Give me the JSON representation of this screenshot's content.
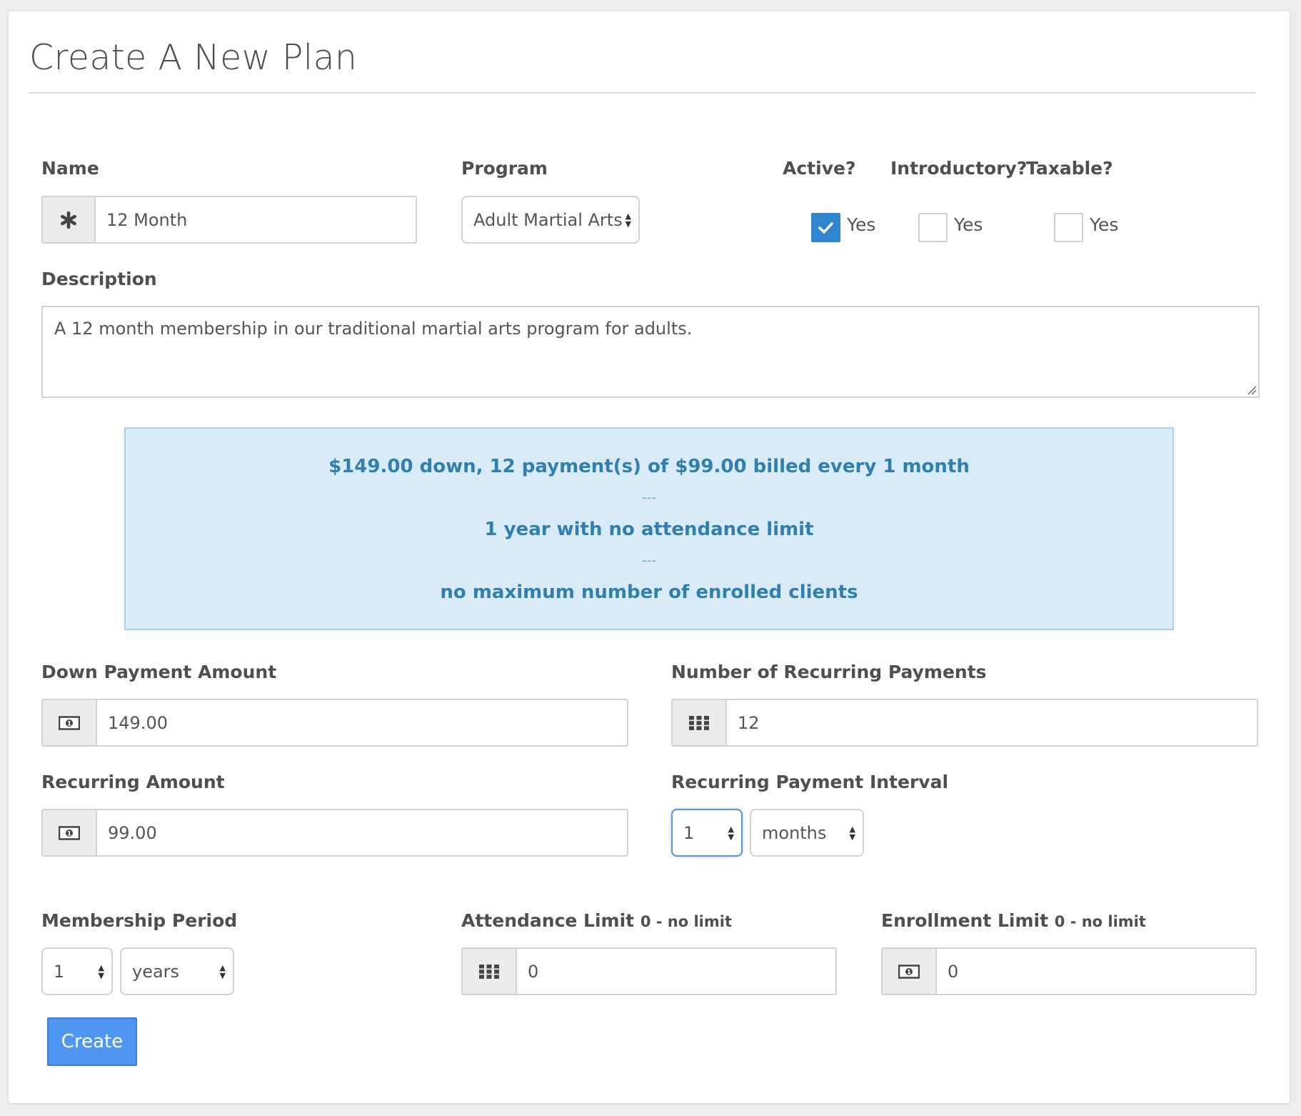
{
  "page": {
    "title": "Create A New Plan"
  },
  "fields": {
    "name": {
      "label": "Name",
      "value": "12 Month",
      "icon": "asterisk-icon"
    },
    "program": {
      "label": "Program",
      "value": "Adult Martial Arts"
    },
    "active": {
      "label": "Active?",
      "option": "Yes",
      "checked": true
    },
    "introductory": {
      "label": "Introductory?",
      "option": "Yes",
      "checked": false
    },
    "taxable": {
      "label": "Taxable?",
      "option": "Yes",
      "checked": false
    },
    "description": {
      "label": "Description",
      "value": "A 12 month membership in our traditional martial arts program for adults."
    },
    "down_payment": {
      "label": "Down Payment Amount",
      "value": "149.00",
      "icon": "money-icon"
    },
    "recurring_payments": {
      "label": "Number of Recurring Payments",
      "value": "12",
      "icon": "grid-icon"
    },
    "recurring_amount": {
      "label": "Recurring Amount",
      "value": "99.00",
      "icon": "money-icon"
    },
    "recurring_interval": {
      "label": "Recurring Payment Interval",
      "count": "1",
      "unit": "months"
    },
    "membership_period": {
      "label": "Membership Period",
      "count": "1",
      "unit": "years"
    },
    "attendance_limit": {
      "label": "Attendance Limit",
      "hint": "0 - no limit",
      "value": "0",
      "icon": "grid-icon"
    },
    "enrollment_limit": {
      "label": "Enrollment Limit",
      "hint": "0 - no limit",
      "value": "0",
      "icon": "money-icon"
    }
  },
  "summary": {
    "line1": "$149.00 down, 12 payment(s) of $99.00 billed every 1 month",
    "separator": "---",
    "line2": "1 year with no attendance limit",
    "line3": "no maximum number of enrolled clients"
  },
  "actions": {
    "create_label": "Create"
  },
  "colors": {
    "accent": "#2f86cf",
    "button": "#4e96f2",
    "summary_bg": "#d9ebf6",
    "summary_text": "#317fae"
  }
}
